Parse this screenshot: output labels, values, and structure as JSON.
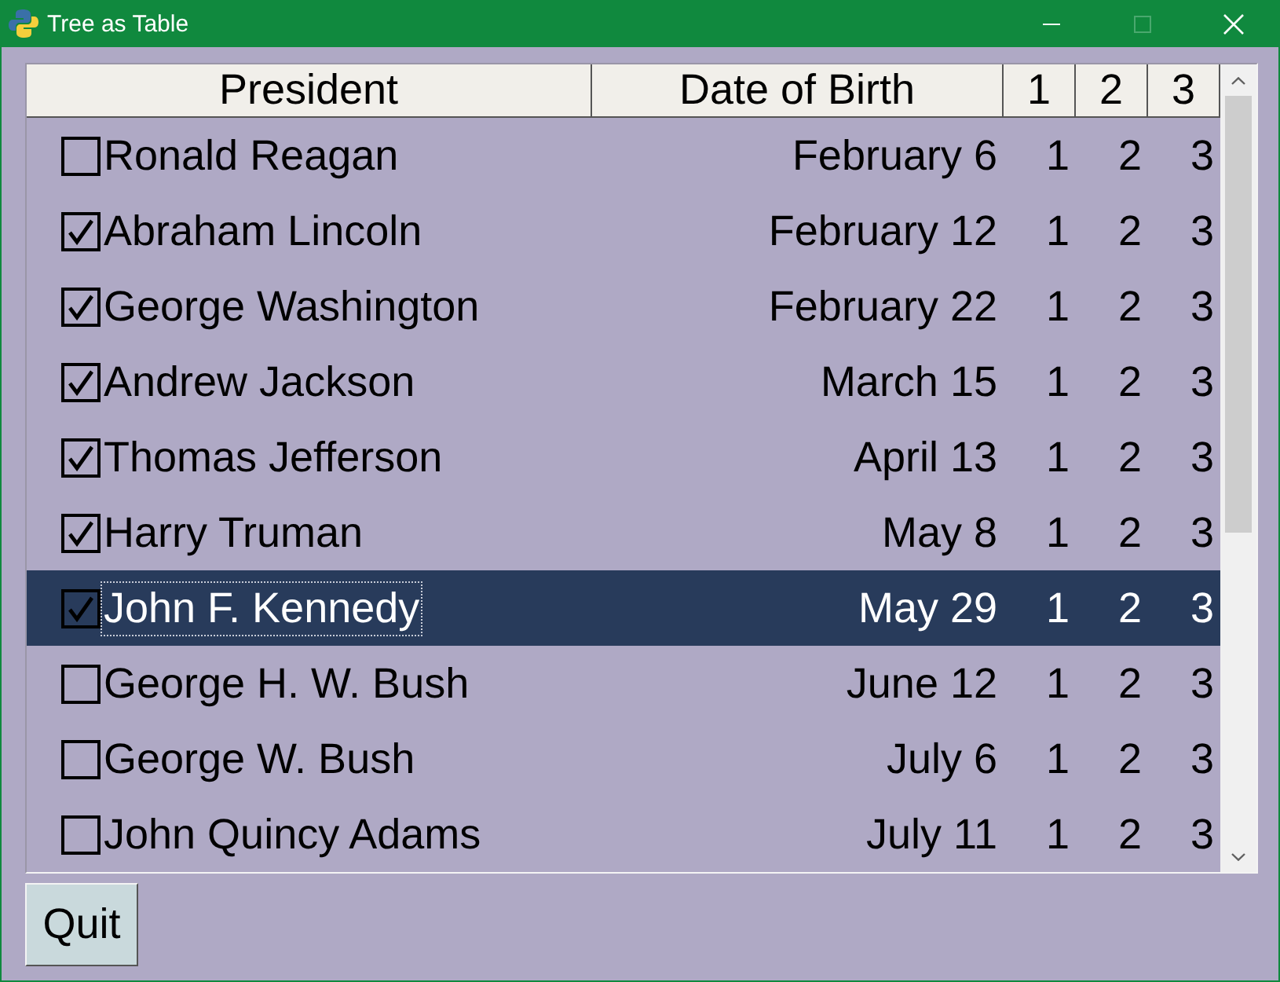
{
  "window": {
    "title": "Tree as Table",
    "controls": [
      {
        "kind": "minimize",
        "disabled": false
      },
      {
        "kind": "maximize",
        "disabled": true
      },
      {
        "kind": "close",
        "disabled": false
      }
    ]
  },
  "table": {
    "columns": [
      "President",
      "Date of Birth",
      "1",
      "2",
      "3"
    ],
    "rows": [
      {
        "name": "Ronald Reagan",
        "cells": [
          "February 6",
          "1",
          "2",
          "3"
        ],
        "checked": false,
        "selected": false,
        "focused": false
      },
      {
        "name": "Abraham Lincoln",
        "cells": [
          "February 12",
          "1",
          "2",
          "3"
        ],
        "checked": true,
        "selected": false,
        "focused": false
      },
      {
        "name": "George Washington",
        "cells": [
          "February 22",
          "1",
          "2",
          "3"
        ],
        "checked": true,
        "selected": false,
        "focused": false
      },
      {
        "name": "Andrew Jackson",
        "cells": [
          "March 15",
          "1",
          "2",
          "3"
        ],
        "checked": true,
        "selected": false,
        "focused": false
      },
      {
        "name": "Thomas Jefferson",
        "cells": [
          "April 13",
          "1",
          "2",
          "3"
        ],
        "checked": true,
        "selected": false,
        "focused": false
      },
      {
        "name": "Harry Truman",
        "cells": [
          "May 8",
          "1",
          "2",
          "3"
        ],
        "checked": true,
        "selected": false,
        "focused": false
      },
      {
        "name": "John F. Kennedy",
        "cells": [
          "May 29",
          "1",
          "2",
          "3"
        ],
        "checked": true,
        "selected": true,
        "focused": true
      },
      {
        "name": "George H. W. Bush",
        "cells": [
          "June 12",
          "1",
          "2",
          "3"
        ],
        "checked": false,
        "selected": false,
        "focused": false
      },
      {
        "name": "George W. Bush",
        "cells": [
          "July 6",
          "1",
          "2",
          "3"
        ],
        "checked": false,
        "selected": false,
        "focused": false
      },
      {
        "name": "John Quincy Adams",
        "cells": [
          "July 11",
          "1",
          "2",
          "3"
        ],
        "checked": false,
        "selected": false,
        "focused": false
      }
    ]
  },
  "buttons": [
    {
      "label": "Quit"
    }
  ]
}
